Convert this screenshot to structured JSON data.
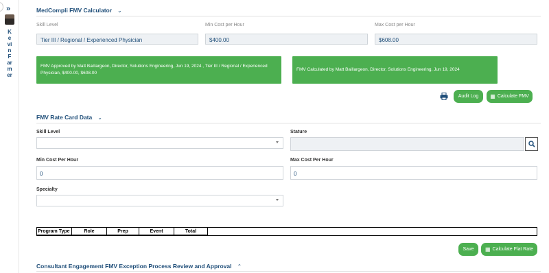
{
  "sidebar": {
    "expand_label": "»",
    "user_name": "Kevin Farmer"
  },
  "calculator": {
    "title": "MedCompli FMV Calculator",
    "fields": {
      "skill_label": "Skill Level",
      "skill_value": "Tier III / Regional / Experienced Physician",
      "min_label": "Min Cost per Hour",
      "min_value": "$400.00",
      "max_label": "Max Cost per Hour",
      "max_value": "$608.00"
    },
    "approved_text": "FMV Approved by Matt Baillargeon, Director, Solutions Engineering, Jun 19, 2024 , Tier III / Regional / Experienced Physician, $400.00, $608.00",
    "calculated_text": "FMV Calculated by Matt Baillargeon, Director, Solutions Engineering, Jun 19, 2024",
    "audit_label": "Audit Log",
    "calc_label": "Calculate FMV"
  },
  "rate_card": {
    "title": "FMV Rate Card Data",
    "skill_label": "Skill Level",
    "stature_label": "Stature",
    "min_label": "Min Cost Per Hour",
    "min_value": "0",
    "max_label": "Max Cost Per Hour",
    "max_value": "0",
    "specialty_label": "Specialty",
    "table_headers": [
      "Program Type",
      "Role",
      "Prep",
      "Event",
      "Total"
    ],
    "save_label": "Save",
    "flat_rate_label": "Calculate Flat Rate"
  },
  "exception": {
    "title": "Consultant Engagement FMV Exception Process Review and Approval"
  },
  "colors": {
    "accent": "#1f4e79",
    "green": "#4caf50"
  }
}
